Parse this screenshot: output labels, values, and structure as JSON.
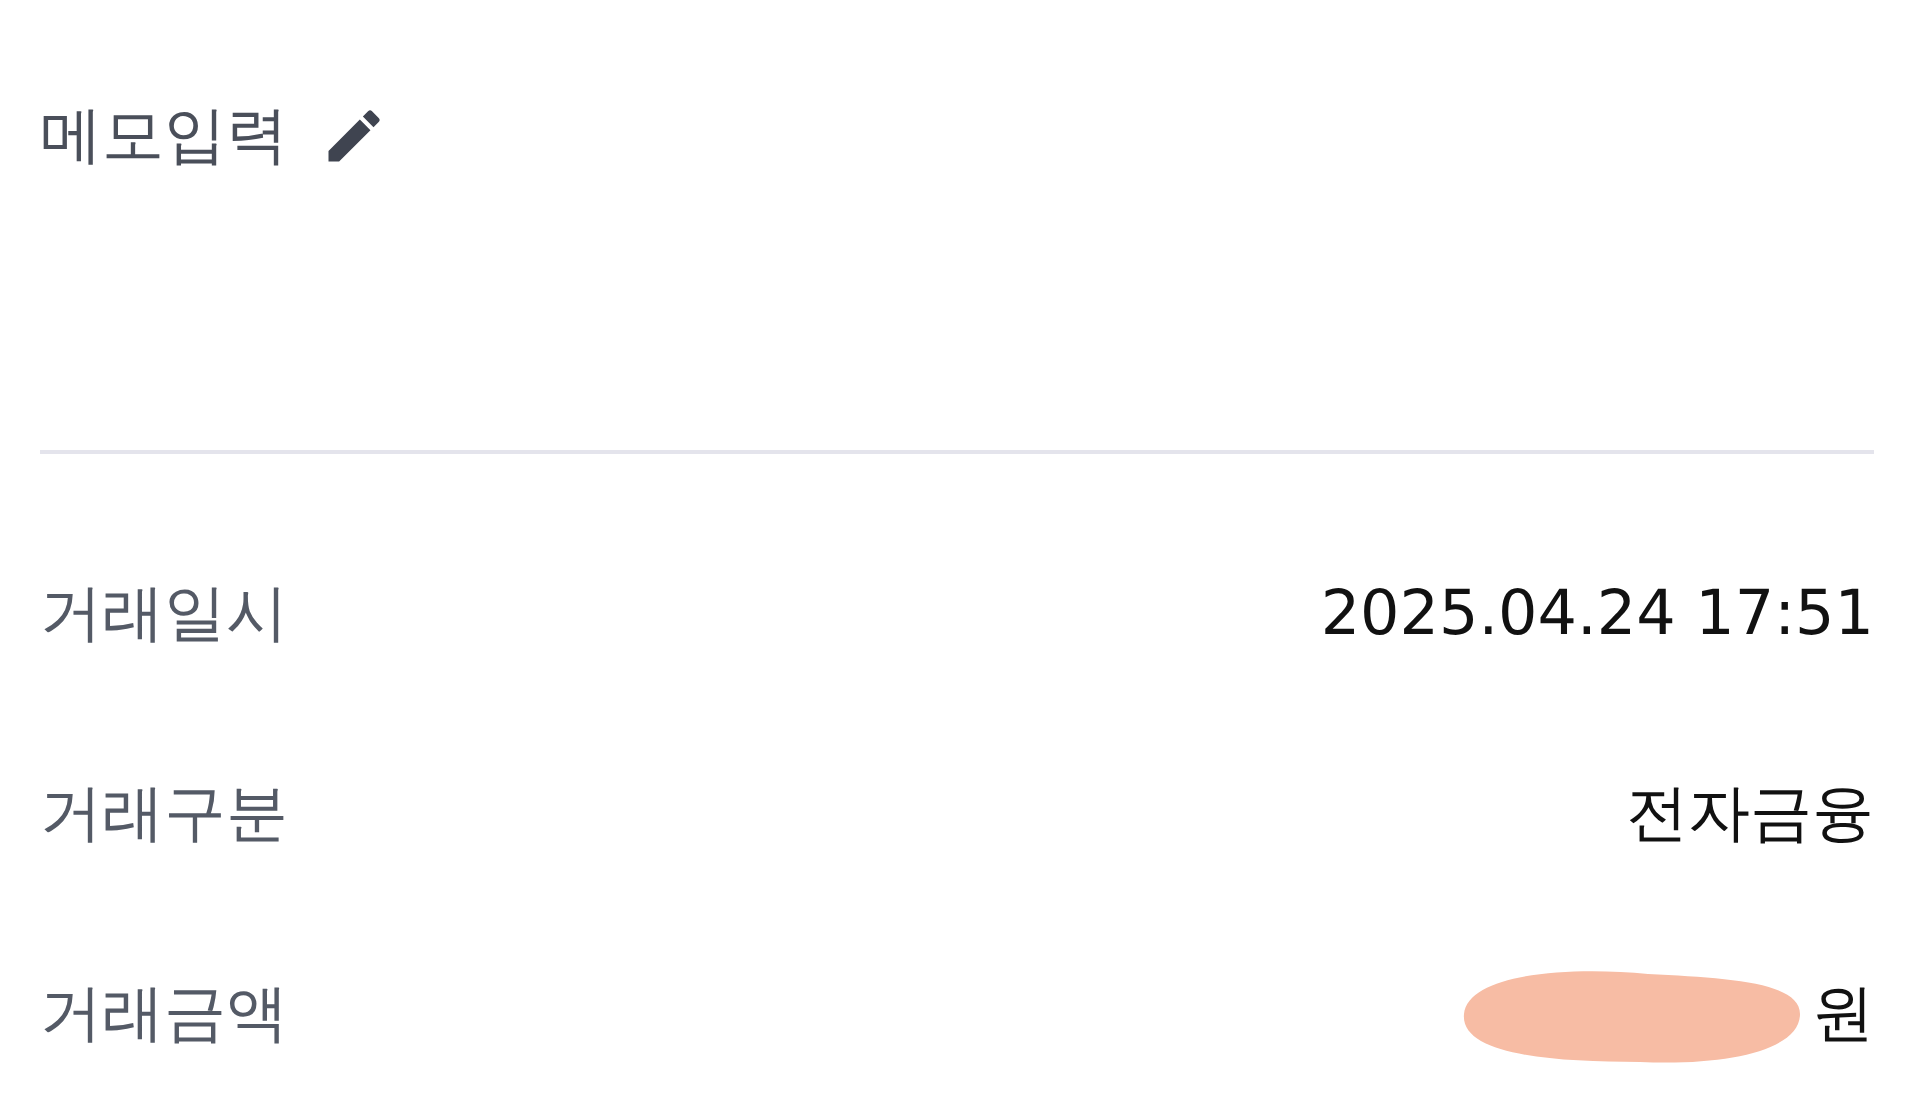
{
  "memo": {
    "label": "메모입력"
  },
  "details": [
    {
      "label": "거래일시",
      "value": "2025.04.24 17:51",
      "redacted": false
    },
    {
      "label": "거래구분",
      "value": "전자금융",
      "redacted": false
    },
    {
      "label": "거래금액",
      "value": "원",
      "redacted": true
    }
  ]
}
